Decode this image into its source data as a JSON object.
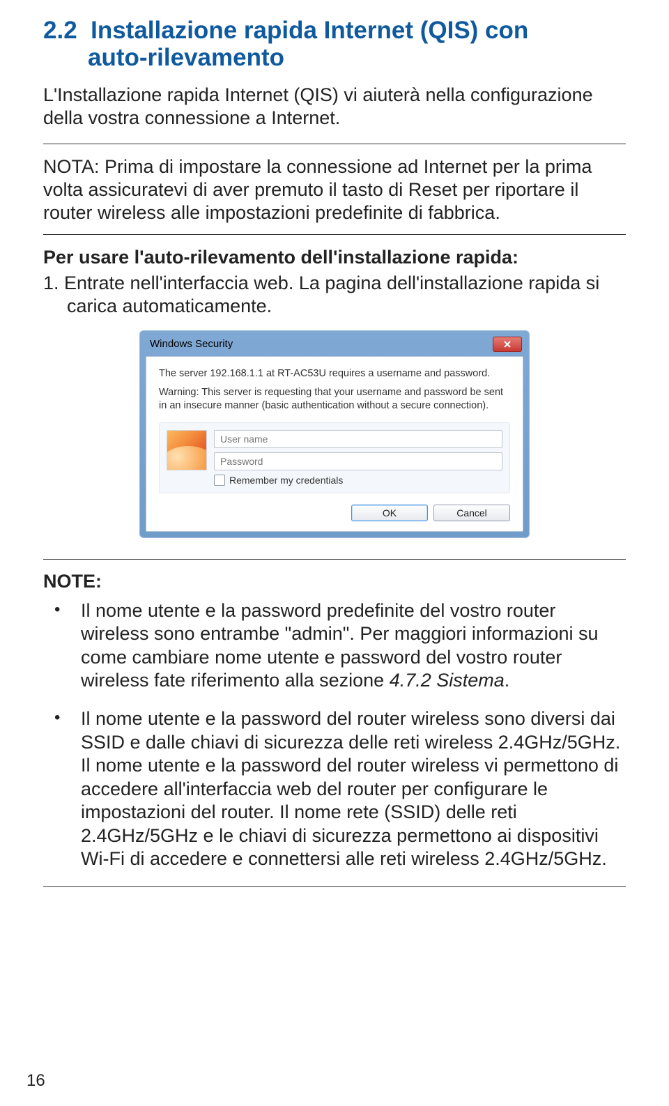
{
  "heading_num": "2.2",
  "heading_rest1": "Installazione rapida Internet (QIS) con",
  "heading_rest2": "auto-rilevamento",
  "lead": "L'Installazione rapida Internet (QIS) vi aiuterà nella configurazione della vostra connessione a Internet.",
  "nota_label": "NOTA:",
  "nota_body": " Prima di impostare la connessione ad Internet per la prima volta assicuratevi di aver premuto il tasto di Reset per riportare il router wireless alle impostazioni predefinite di fabbrica.",
  "steps_title": "Per usare l'auto-rilevamento dell'installazione rapida:",
  "step1_num": "1.",
  "step1": "Entrate nell'interfaccia web. La pagina dell'installazione rapida si carica automaticamente.",
  "dialog": {
    "title": "Windows Security",
    "msg": "The server 192.168.1.1 at RT-AC53U requires a username and password.",
    "warning": "Warning: This server is requesting that your username and password be sent in an insecure manner (basic authentication without a secure connection).",
    "username_placeholder": "User name",
    "password_placeholder": "Password",
    "remember": "Remember my credentials",
    "ok": "OK",
    "cancel": "Cancel"
  },
  "note_label": "NOTE:",
  "note1_a": "Il nome utente e la password predefinite del vostro router wireless sono entrambe \"admin\". Per maggiori informazioni su come cambiare nome utente e password del vostro router wireless fate riferimento alla sezione ",
  "note1_b": "4.7.2 Sistema",
  "note1_c": ".",
  "note2": "Il nome utente e la password del router wireless sono diversi dai SSID e dalle chiavi di sicurezza delle reti wireless 2.4GHz/5GHz. Il nome utente e la password del router wireless vi permettono di accedere all'interfaccia web del router per configurare le impostazioni del router. Il nome rete (SSID) delle reti 2.4GHz/5GHz e le chiavi di sicurezza permettono ai dispositivi Wi-Fi di accedere e connettersi alle reti wireless 2.4GHz/5GHz.",
  "page_number": "16"
}
